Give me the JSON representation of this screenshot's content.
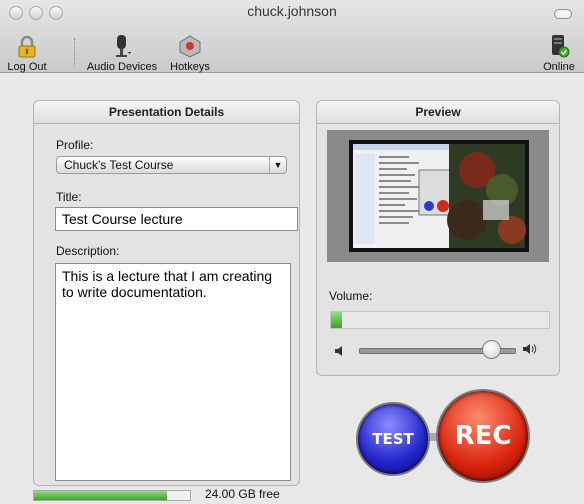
{
  "window": {
    "title": "chuck.johnson"
  },
  "toolbar": {
    "logout": "Log Out",
    "audio_devices": "Audio Devices",
    "hotkeys": "Hotkeys",
    "online": "Online"
  },
  "details": {
    "header": "Presentation Details",
    "profile_label": "Profile:",
    "profile_value": "Chuck's Test Course",
    "title_label": "Title:",
    "title_value": "Test Course lecture",
    "description_label": "Description:",
    "description_value": "This is a lecture that I am creating to write documentation."
  },
  "preview": {
    "header": "Preview",
    "volume_label": "Volume:",
    "input_level": 0.05,
    "volume_level": 0.85
  },
  "controls": {
    "test": "TEST",
    "rec": "REC"
  },
  "disk": {
    "free_text": "24.00 GB free",
    "fill_fraction": 0.85
  },
  "colors": {
    "rec": "#d9230c",
    "test": "#2124c9",
    "level_green": "#39a326"
  }
}
